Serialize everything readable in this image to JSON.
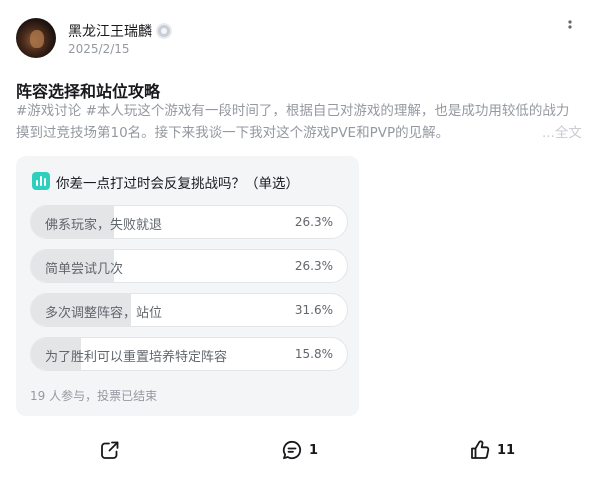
{
  "author": {
    "name": "黑龙江王瑞麟",
    "badge_icon": "level-badge-icon",
    "avatar": "user-avatar"
  },
  "post": {
    "date": "2025/2/15",
    "title": "阵容选择和站位攻略",
    "body_line1": "#游戏讨论 #本人玩这个游戏有一段时间了，根据自己对游戏的理解，也是成功用较低的战力",
    "body_line2": "摸到过竞技场第10名。接下来我谈一下我对这个游戏PVE和PVP的见解。",
    "full_text_label": "...全文"
  },
  "poll": {
    "question": "你差一点打过时会反复挑战吗？（单选）",
    "options": [
      {
        "label": "佛系玩家，失败就退",
        "percent_text": "26.3%",
        "fraction": 0.263
      },
      {
        "label": "简单尝试几次",
        "percent_text": "26.3%",
        "fraction": 0.263
      },
      {
        "label": "多次调整阵容，站位",
        "percent_text": "31.6%",
        "fraction": 0.316
      },
      {
        "label": "为了胜利可以重置培养特定阵容",
        "percent_text": "15.8%",
        "fraction": 0.158
      }
    ],
    "stats": "19 人参与，投票已结束"
  },
  "actions": {
    "share_icon": "share-icon",
    "comment_icon": "comment-icon",
    "comment_count": "1",
    "like_icon": "thumbs-up-icon",
    "like_count": "11"
  },
  "colors": {
    "poll_bg": "#f4f5f7",
    "poll_fill": "#e3e5e7",
    "poll_icon": "#2fcfbd",
    "muted_text": "#9499a0"
  }
}
